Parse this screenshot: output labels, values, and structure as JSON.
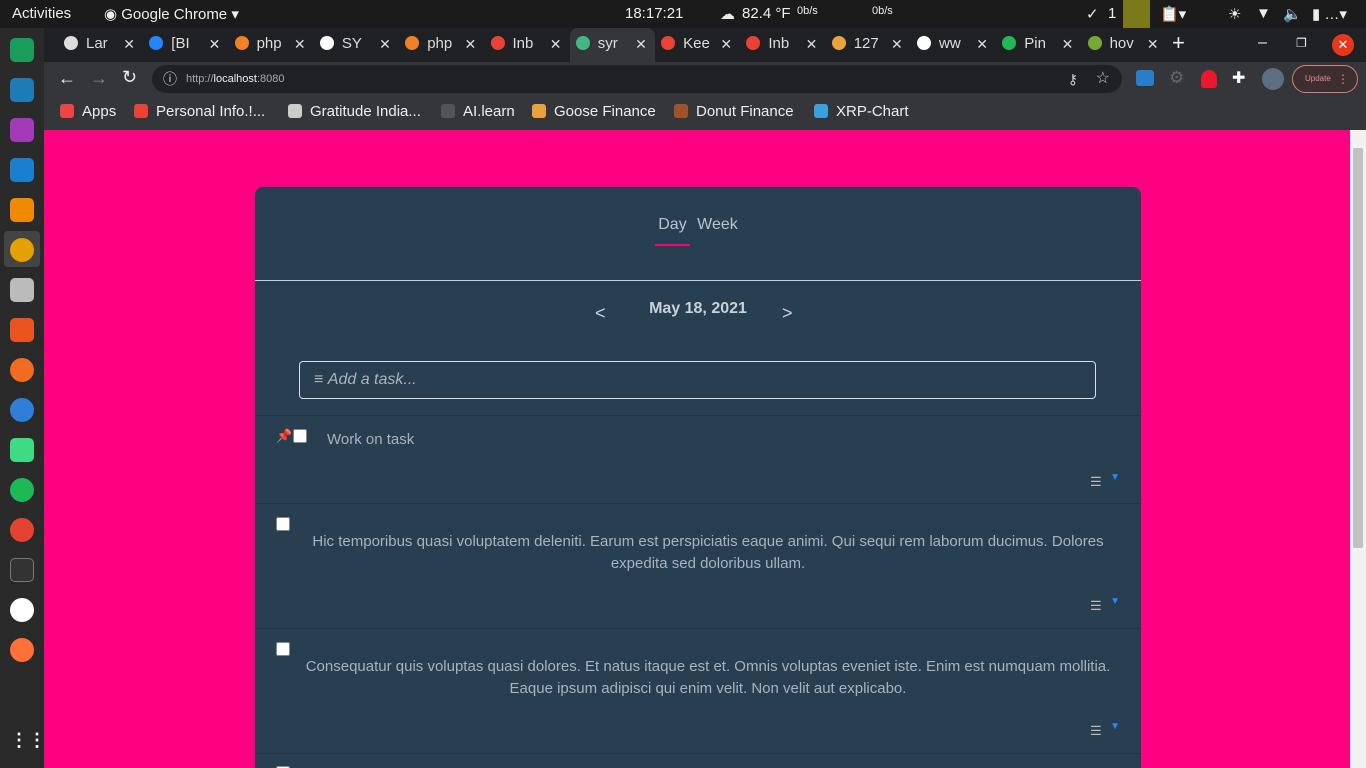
{
  "system": {
    "activities": "Activities",
    "app": "Google Chrome",
    "time": "18:17:21",
    "temp": "82.4 °F",
    "net_down": "0b/s",
    "net_up": "0b/s",
    "tasks_count": "1"
  },
  "browser": {
    "tabs": [
      "Lar",
      "[BI",
      "php",
      "SY",
      "php",
      "Inb",
      "syr",
      "Kee",
      "Inb",
      "127",
      "ww",
      "Pin",
      "hov"
    ],
    "active_tab": 6,
    "url_prefix": "http://",
    "url_host": "localhost",
    "url_port": ":8080",
    "update_label": "Update",
    "bookmarks": [
      "Apps",
      "Personal Info.!...",
      "Gratitude India...",
      "AI.learn",
      "Goose Finance",
      "Donut Finance",
      "XRP-Chart"
    ]
  },
  "app": {
    "views": [
      "Day",
      "Week"
    ],
    "date": "May 18, 2021",
    "prev": "<",
    "next": ">",
    "add_placeholder": "Add a task...",
    "tasks": [
      {
        "text": "Work on task",
        "pinned": true
      },
      {
        "text": "Hic temporibus quasi voluptatem deleniti. Earum est perspiciatis eaque animi. Qui sequi rem laborum ducimus. Dolores expedita sed doloribus ullam."
      },
      {
        "text": "Consequatur quis voluptas quasi dolores. Et natus itaque est et. Omnis voluptas eveniet iste. Enim est numquam mollitia. Eaque ipsum adipisci qui enim velit. Non velit aut explicabo."
      }
    ]
  },
  "colors": {
    "page_bg": "#ff0080",
    "card_bg": "#283e51",
    "accent": "#ff0080"
  }
}
